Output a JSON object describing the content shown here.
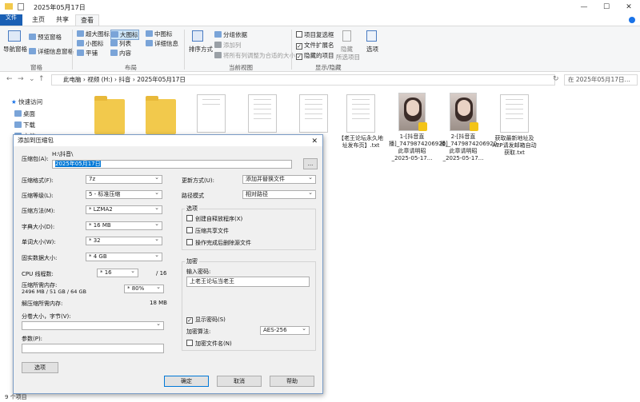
{
  "window": {
    "title": "2025年05月17日",
    "minimize": "—",
    "maximize": "☐",
    "close": "✕"
  },
  "tabs": [
    "文件",
    "主页",
    "共享",
    "查看"
  ],
  "ribbon": {
    "panes": {
      "nav_pane": "导航窗格",
      "preview": "预览窗格",
      "details": "详细信息窗格",
      "group": "窗格"
    },
    "layout": {
      "items": [
        "超大图标",
        "大图标",
        "中图标",
        "小图标",
        "列表",
        "详细信息",
        "平铺",
        "内容"
      ],
      "group": "布局"
    },
    "sort": "排序方式",
    "view": {
      "group_by": "分组依据",
      "add_col": "添加列",
      "fit_cols": "将所有列调整为合适的大小",
      "group": "当前视图"
    },
    "show": {
      "item_cb": "项目复选框",
      "ext": "文件扩展名",
      "hidden": "隐藏的项目",
      "hide": "隐藏",
      "hide_sel": "所选项目",
      "options": "选项",
      "group": "显示/隐藏"
    }
  },
  "address": {
    "crumbs": "此电脑  ›  视频 (H:)  ›  抖音  ›  2025年05月17日",
    "search_placeholder": "在 2025年05月17日..."
  },
  "sidebar": {
    "quick": "快速访问",
    "items": [
      "桌面",
      "下载",
      "文档"
    ]
  },
  "files": [
    {
      "name": "",
      "kind": "folder"
    },
    {
      "name": "",
      "kind": "folder"
    },
    {
      "name": "",
      "kind": "doc"
    },
    {
      "name": "",
      "kind": "doc"
    },
    {
      "name": "",
      "kind": "doc"
    },
    {
      "name": "【老王论坛永久地址发布页】.txt",
      "kind": "doc"
    },
    {
      "name": "1-[抖音直播]_7479874206920_此章请明昭_2025-05-17...",
      "kind": "thumb"
    },
    {
      "name": "2-[抖音直播]_7479874206920_此章请明昭_2025-05-17...",
      "kind": "thumb"
    },
    {
      "name": "获取最新地址及APP请发邮箱自动获取.txt",
      "kind": "doc"
    }
  ],
  "status": {
    "count": "9 个项目"
  },
  "dialog": {
    "title": "添加到压缩包",
    "close": "✕",
    "archive_label": "压缩包(A):",
    "path": "H:\\抖音\\",
    "archive_value": "2025年05月17日",
    "browse": "...",
    "left": [
      {
        "label": "压缩格式(F):",
        "value": "7z"
      },
      {
        "label": "压缩等级(L):",
        "value": "5 - 标准压缩"
      },
      {
        "label": "压缩方法(M):",
        "value": "* LZMA2"
      },
      {
        "label": "字典大小(D):",
        "value": "* 16 MB"
      },
      {
        "label": "单词大小(W):",
        "value": "* 32"
      },
      {
        "label": "固实数据大小:",
        "value": "* 4 GB"
      }
    ],
    "cpu_label": "CPU 线程数:",
    "cpu_value": "* 16",
    "cpu_max": "/ 16",
    "mem_label": "压缩所需内存:",
    "mem_detail": "2496 MB / 51 GB / 64 GB",
    "mem_value": "* 80%",
    "dmem_label": "解压缩所需内存:",
    "dmem_value": "18 MB",
    "split_label": "分卷大小，字节(V):",
    "params_label": "参数(P):",
    "options_btn": "选项",
    "update_label": "更新方式(U):",
    "update_value": "添加并替换文件",
    "pathmode_label": "路径模式",
    "pathmode_value": "相对路径",
    "opts_title": "选项",
    "opts": [
      "创建自释放程序(X)",
      "压缩共享文件",
      "操作完成后删除源文件"
    ],
    "enc_title": "加密",
    "pwd_label": "输入密码:",
    "pwd_value": "上老王论坛当老王",
    "show_pwd": "显示密码(S)",
    "enc_method_label": "加密算法:",
    "enc_method_value": "AES-256",
    "enc_names": "加密文件名(N)",
    "ok": "确定",
    "cancel": "取消",
    "help": "帮助"
  }
}
